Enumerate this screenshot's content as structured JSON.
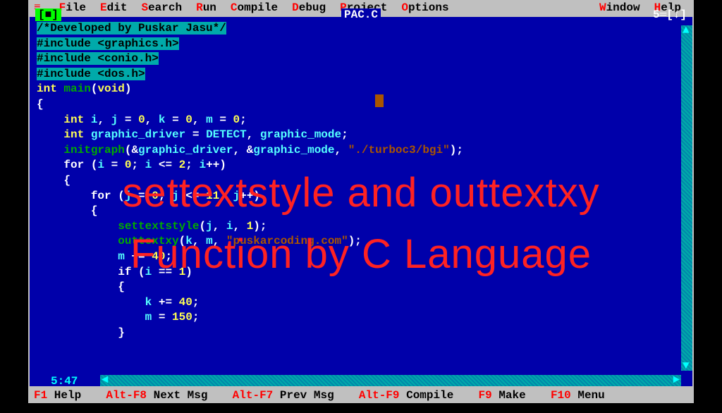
{
  "menu": {
    "items": [
      {
        "hotkey": "F",
        "rest": "ile"
      },
      {
        "hotkey": "E",
        "rest": "dit"
      },
      {
        "hotkey": "S",
        "rest": "earch"
      },
      {
        "hotkey": "R",
        "rest": "un"
      },
      {
        "hotkey": "C",
        "rest": "ompile"
      },
      {
        "hotkey": "D",
        "rest": "ebug"
      },
      {
        "hotkey": "P",
        "rest": "roject"
      },
      {
        "hotkey": "O",
        "rest": "ptions"
      },
      {
        "hotkey": "W",
        "rest": "indow"
      },
      {
        "hotkey": "H",
        "rest": "elp"
      }
    ]
  },
  "window": {
    "filename": "PAC.C",
    "left_indicator": "[■]",
    "right_indicator": "5═[↕]",
    "cursor_position": "5:47"
  },
  "code": {
    "lines": [
      {
        "cls": "hl-teal",
        "text": "/*Developed by Puskar Jasu*/"
      },
      {
        "cls": "hl-teal",
        "text": "#include <graphics.h>"
      },
      {
        "cls": "hl-teal",
        "text": "#include <conio.h>"
      },
      {
        "cls": "hl-teal",
        "text": "#include <dos.h>"
      },
      {
        "html": "<span class='type'>int</span> <span class='func'>main</span>(<span class='type'>void</span>)"
      },
      {
        "html": "<span class='op'>{</span>"
      },
      {
        "html": "    <span class='type'>int</span> <span class='ident'>i</span>, <span class='ident'>j</span> = <span class='num'>0</span>, <span class='ident'>k</span> = <span class='num'>0</span>, <span class='ident'>m</span> = <span class='num'>0</span>;"
      },
      {
        "html": "    <span class='type'>int</span> <span class='ident'>graphic_driver</span> = <span class='ident'>DETECT</span>, <span class='ident'>graphic_mode</span>;"
      },
      {
        "html": "    <span class='func'>initgraph</span>(<span class='op'>&amp;</span><span class='ident'>graphic_driver</span>, <span class='op'>&amp;</span><span class='ident'>graphic_mode</span>, <span class='str'>\"./turboc3/bgi\"</span>);"
      },
      {
        "html": "    <span class='kw'>for</span> (<span class='ident'>i</span> = <span class='num'>0</span>; <span class='ident'>i</span> &lt;= <span class='num'>2</span>; <span class='ident'>i</span>++)"
      },
      {
        "html": "    <span class='op'>{</span>"
      },
      {
        "html": "        <span class='kw'>for</span> (<span class='ident'>j</span> = <span class='num'>0</span>; <span class='ident'>j</span> &lt;= <span class='num'>11</span>; <span class='ident'>j</span>++)"
      },
      {
        "html": "        <span class='op'>{</span>"
      },
      {
        "html": "            <span class='func'>settextstyle</span>(<span class='ident'>j</span>, <span class='ident'>i</span>, <span class='num'>1</span>);"
      },
      {
        "html": "            <span class='func'>outtextxy</span>(<span class='ident'>k</span>, <span class='ident'>m</span>, <span class='str'>\"puskarcoding.com\"</span>);"
      },
      {
        "html": "            <span class='ident'>m</span> += <span class='num'>40</span>;"
      },
      {
        "html": "            <span class='kw'>if</span> (<span class='ident'>i</span> == <span class='num'>1</span>)"
      },
      {
        "html": "            <span class='op'>{</span>"
      },
      {
        "html": "                <span class='ident'>k</span> += <span class='num'>40</span>;"
      },
      {
        "html": "                <span class='ident'>m</span> = <span class='num'>150</span>;"
      },
      {
        "html": "            <span class='op'>}</span>"
      }
    ]
  },
  "status": {
    "items": [
      {
        "key": "F1",
        "label": " Help"
      },
      {
        "key": "Alt-F8",
        "label": " Next Msg"
      },
      {
        "key": "Alt-F7",
        "label": " Prev Msg"
      },
      {
        "key": "Alt-F9",
        "label": " Compile"
      },
      {
        "key": "F9",
        "label": " Make"
      },
      {
        "key": "F10",
        "label": " Menu"
      }
    ]
  },
  "overlay": {
    "line1": "settextstyle and outtextxy",
    "line2": "Function by C Language"
  }
}
